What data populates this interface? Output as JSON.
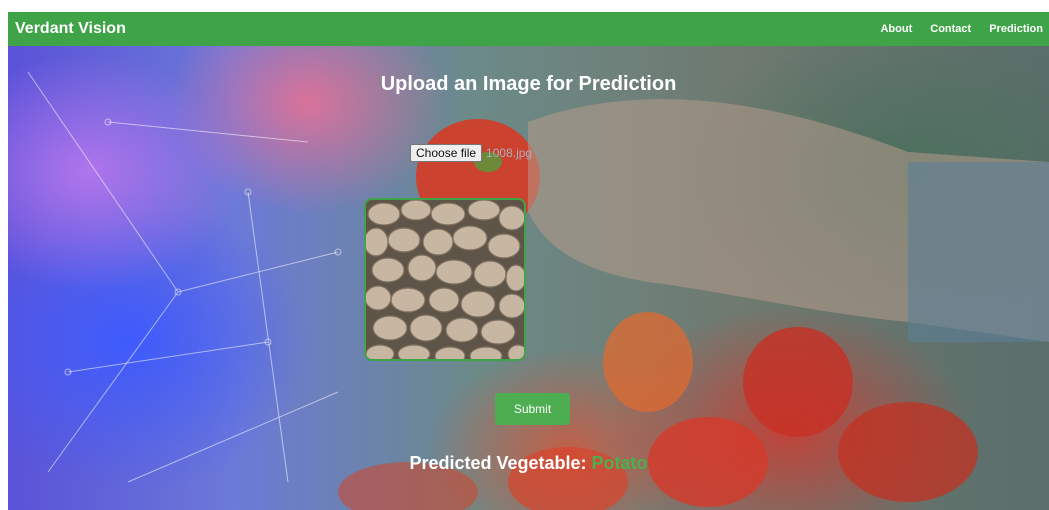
{
  "app": {
    "brand": "Verdant Vision"
  },
  "nav": {
    "links": [
      "About",
      "Contact",
      "Prediction"
    ]
  },
  "upload": {
    "heading": "Upload an Image for Prediction",
    "choose_file_label": "Choose file",
    "file_name": "1008.jpg"
  },
  "actions": {
    "submit_label": "Submit"
  },
  "result": {
    "label": "Predicted Vegetable:",
    "value": "Potato"
  },
  "colors": {
    "accent": "#3fa447",
    "button": "#4cae50",
    "result": "#4cae50"
  }
}
